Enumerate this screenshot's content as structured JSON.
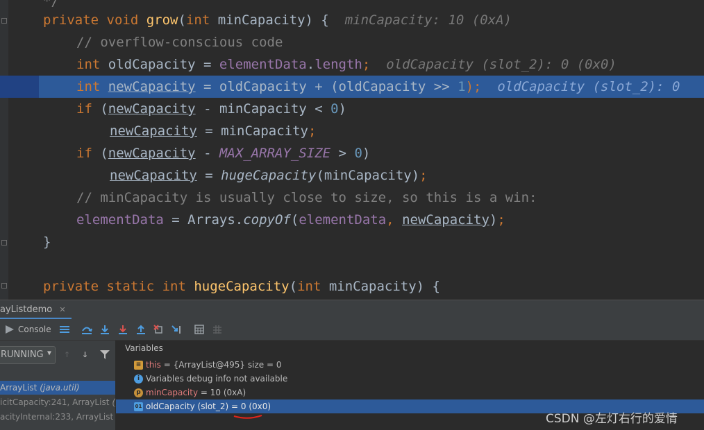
{
  "editor": {
    "lines": [
      {
        "tokens": [
          {
            "t": "*/",
            "c": "cm"
          }
        ]
      },
      {
        "tokens": [
          {
            "t": "private void ",
            "c": "kw"
          },
          {
            "t": "grow",
            "c": "fn"
          },
          {
            "t": "(",
            "c": ""
          },
          {
            "t": "int ",
            "c": "kw"
          },
          {
            "t": "minCapacity) {  ",
            "c": ""
          },
          {
            "t": "minCapacity: 10 (0xA)",
            "c": "hint"
          }
        ]
      },
      {
        "tokens": [
          {
            "t": "// overflow-conscious code",
            "c": "cm"
          }
        ]
      },
      {
        "tokens": [
          {
            "t": "int ",
            "c": "kw"
          },
          {
            "t": "oldCapacity = ",
            "c": ""
          },
          {
            "t": "elementData",
            "c": "fld"
          },
          {
            "t": ".",
            "c": ""
          },
          {
            "t": "length",
            "c": "fld"
          },
          {
            "t": ";  ",
            "c": "kw"
          },
          {
            "t": "oldCapacity (slot_2): 0 (0x0)",
            "c": "hint"
          }
        ]
      },
      {
        "tokens": [
          {
            "t": "int ",
            "c": "kw"
          },
          {
            "t": "newCapacity",
            "c": "ul"
          },
          {
            "t": " = oldCapacity + (oldCapacity >> ",
            "c": ""
          },
          {
            "t": "1",
            "c": "num"
          },
          {
            "t": ");  ",
            "c": "kw"
          },
          {
            "t": "oldCapacity (slot_2): 0",
            "c": "hint"
          }
        ]
      },
      {
        "tokens": [
          {
            "t": "if ",
            "c": "kw"
          },
          {
            "t": "(",
            "c": ""
          },
          {
            "t": "newCapacity",
            "c": "ul"
          },
          {
            "t": " - minCapacity < ",
            "c": ""
          },
          {
            "t": "0",
            "c": "num"
          },
          {
            "t": ")",
            "c": ""
          }
        ]
      },
      {
        "tokens": [
          {
            "t": "newCapacity",
            "c": "ul"
          },
          {
            "t": " = minCapacity",
            "c": ""
          },
          {
            "t": ";",
            "c": "kw"
          }
        ]
      },
      {
        "tokens": [
          {
            "t": "if ",
            "c": "kw"
          },
          {
            "t": "(",
            "c": ""
          },
          {
            "t": "newCapacity",
            "c": "ul"
          },
          {
            "t": " - ",
            "c": ""
          },
          {
            "t": "MAX_ARRAY_SIZE",
            "c": "fld it"
          },
          {
            "t": " > ",
            "c": ""
          },
          {
            "t": "0",
            "c": "num"
          },
          {
            "t": ")",
            "c": ""
          }
        ]
      },
      {
        "tokens": [
          {
            "t": "newCapacity",
            "c": "ul"
          },
          {
            "t": " = ",
            "c": ""
          },
          {
            "t": "hugeCapacity",
            "c": "it"
          },
          {
            "t": "(minCapacity)",
            "c": ""
          },
          {
            "t": ";",
            "c": "kw"
          }
        ]
      },
      {
        "tokens": [
          {
            "t": "// minCapacity is usually close to size, so this is a win:",
            "c": "cm"
          }
        ]
      },
      {
        "tokens": [
          {
            "t": "elementData",
            "c": "fld"
          },
          {
            "t": " = Arrays.",
            "c": ""
          },
          {
            "t": "copyOf",
            "c": "it"
          },
          {
            "t": "(",
            "c": ""
          },
          {
            "t": "elementData",
            "c": "fld"
          },
          {
            "t": ", ",
            "c": "kw"
          },
          {
            "t": "newCapacity",
            "c": "ul"
          },
          {
            "t": ")",
            "c": ""
          },
          {
            "t": ";",
            "c": "kw"
          }
        ]
      },
      {
        "tokens": [
          {
            "t": "}",
            "c": ""
          }
        ]
      },
      {
        "tokens": []
      },
      {
        "tokens": [
          {
            "t": "private static int ",
            "c": "kw"
          },
          {
            "t": "hugeCapacity",
            "c": "fn"
          },
          {
            "t": "(",
            "c": ""
          },
          {
            "t": "int ",
            "c": "kw"
          },
          {
            "t": "minCapacity) {",
            "c": ""
          }
        ]
      }
    ]
  },
  "debug": {
    "tab_label": "ayListdemo",
    "console_label": "Console",
    "thread_label": "RUNNING",
    "variables_header": "Variables",
    "frames": [
      {
        "method": "ArrayList",
        "pkg": "(java.util)"
      },
      {
        "method": "icitCapacity:241, ArrayList",
        "pkg": "(ja"
      },
      {
        "method": "acityInternal:233, ArrayList",
        "pkg": "(ja"
      }
    ],
    "variables": [
      {
        "name": "this",
        "value": " = {ArrayList@495}  size = 0"
      },
      {
        "name": "",
        "value": "Variables debug info not available"
      },
      {
        "name": "minCapacity",
        "value": " = 10 (0xA)"
      },
      {
        "name": "oldCapacity (slot_2)",
        "value": " = 0 (0x0)"
      }
    ]
  },
  "watermark": "CSDN @左灯右行的爱情",
  "colors": {
    "accent": "#4a88c7",
    "selection": "#2d5a99",
    "background": "#2b2b2b"
  }
}
